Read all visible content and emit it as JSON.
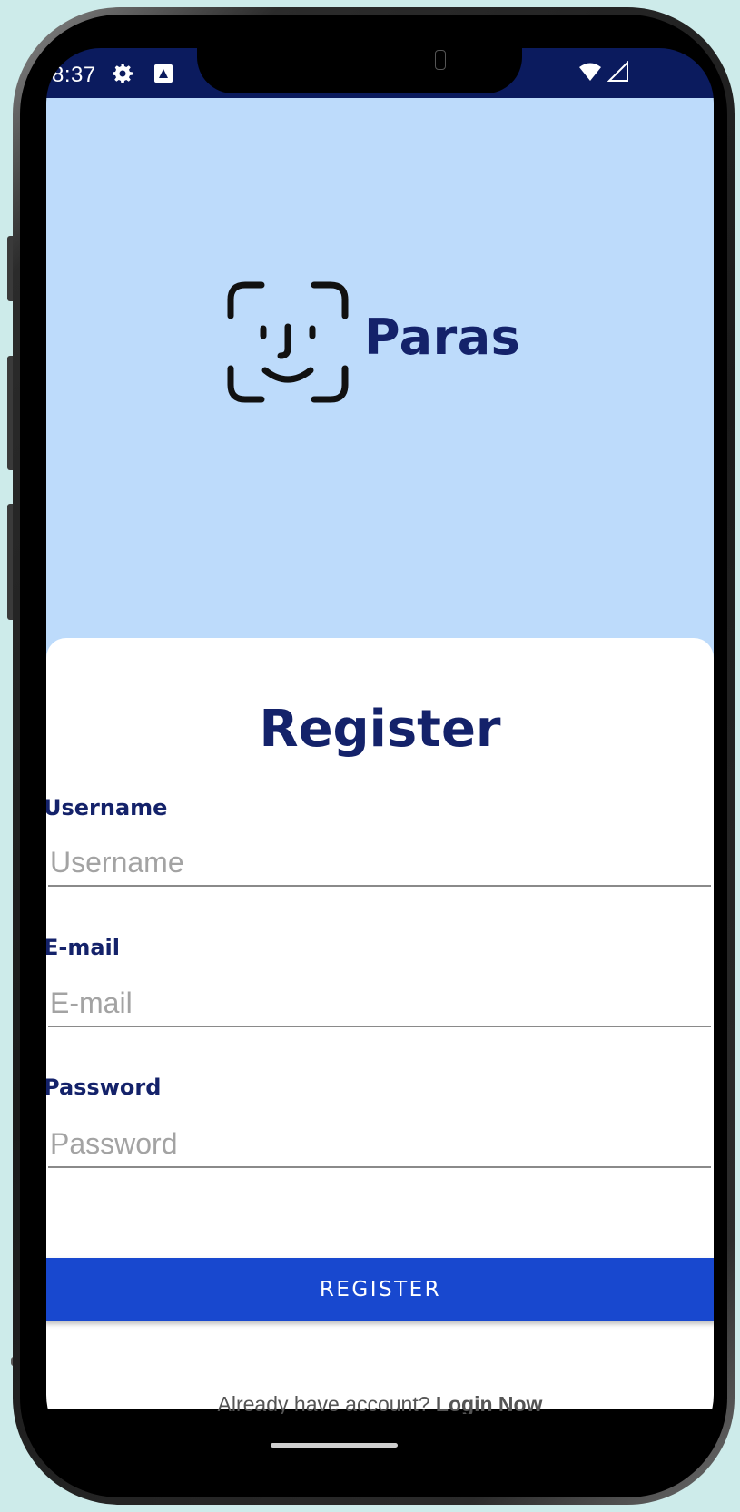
{
  "status_bar": {
    "time": "8:37",
    "icons": [
      "gear-icon",
      "a-icon",
      "wifi-icon",
      "signal-icon"
    ]
  },
  "brand": {
    "name": "Paras",
    "logo_icon": "face-id-icon",
    "color": "#14226a",
    "hero_background": "#bddbfb"
  },
  "form": {
    "title": "Register",
    "username": {
      "label": "Username",
      "placeholder": "Username",
      "value": ""
    },
    "email": {
      "label": "E-mail",
      "placeholder": "E-mail",
      "value": ""
    },
    "password": {
      "label": "Password",
      "placeholder": "Password",
      "value": ""
    },
    "submit_label": "REGISTER",
    "submit_color": "#1848cf"
  },
  "footer": {
    "prompt": "Already have account?",
    "login_link": "Login Now"
  }
}
